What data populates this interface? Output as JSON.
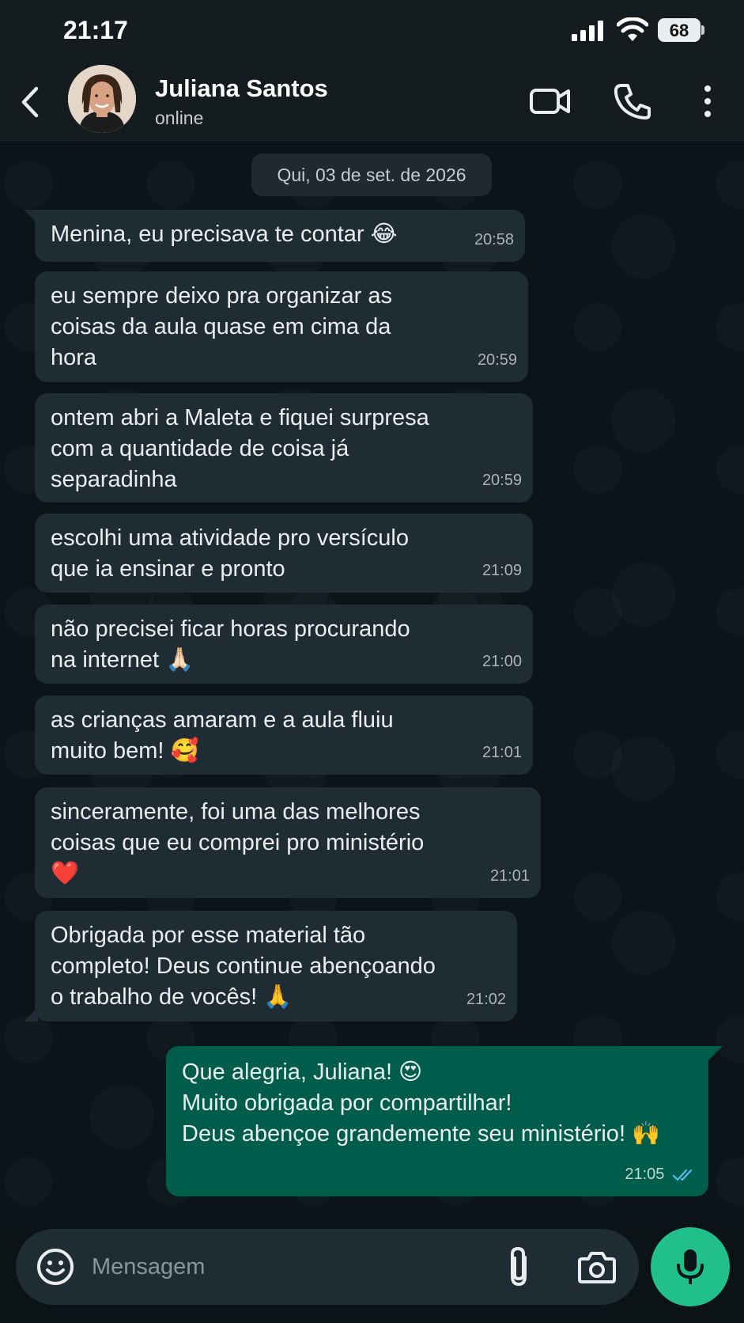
{
  "status_bar": {
    "time": "21:17",
    "battery": "68"
  },
  "header": {
    "name": "Juliana Santos",
    "status": "online"
  },
  "date_chip": "Qui, 03 de set. de 2026",
  "messages": [
    {
      "text": "Menina, eu precisava te contar 😂",
      "time": "20:58"
    },
    {
      "text": "eu sempre deixo pra organizar as\ncoisas da aula quase em cima da\nhora",
      "time": "20:59"
    },
    {
      "text": "ontem abri a Maleta e fiquei surpresa\ncom a quantidade de coisa já\nseparadinha",
      "time": "20:59"
    },
    {
      "text": "escolhi uma atividade pro versículo\nque ia ensinar e pronto",
      "time": "21:09"
    },
    {
      "text": "não precisei ficar horas procurando\nna internet 🙏🏻",
      "time": "21:00"
    },
    {
      "text": "as crianças amaram e a aula fluiu\nmuito bem! 🥰",
      "time": "21:01"
    },
    {
      "text": "sinceramente, foi uma das melhores\ncoisas que eu comprei pro ministério\n❤️",
      "time": "21:01"
    },
    {
      "text": "Obrigada por esse material tão\ncompleto! Deus continue abençoando\no trabalho de vocês! 🙏",
      "time": "21:02"
    }
  ],
  "reply": {
    "text": "Que alegria, Juliana! 😍\nMuito obrigada por compartilhar!\nDeus abençoe grandemente seu ministério! 🙌",
    "time": "21:05"
  },
  "composer": {
    "placeholder": "Mensagem"
  },
  "colors": {
    "incoming": "#202c33",
    "outgoing": "#005c4b",
    "mic": "#21c08b",
    "read_ticks": "#53bdeb"
  }
}
